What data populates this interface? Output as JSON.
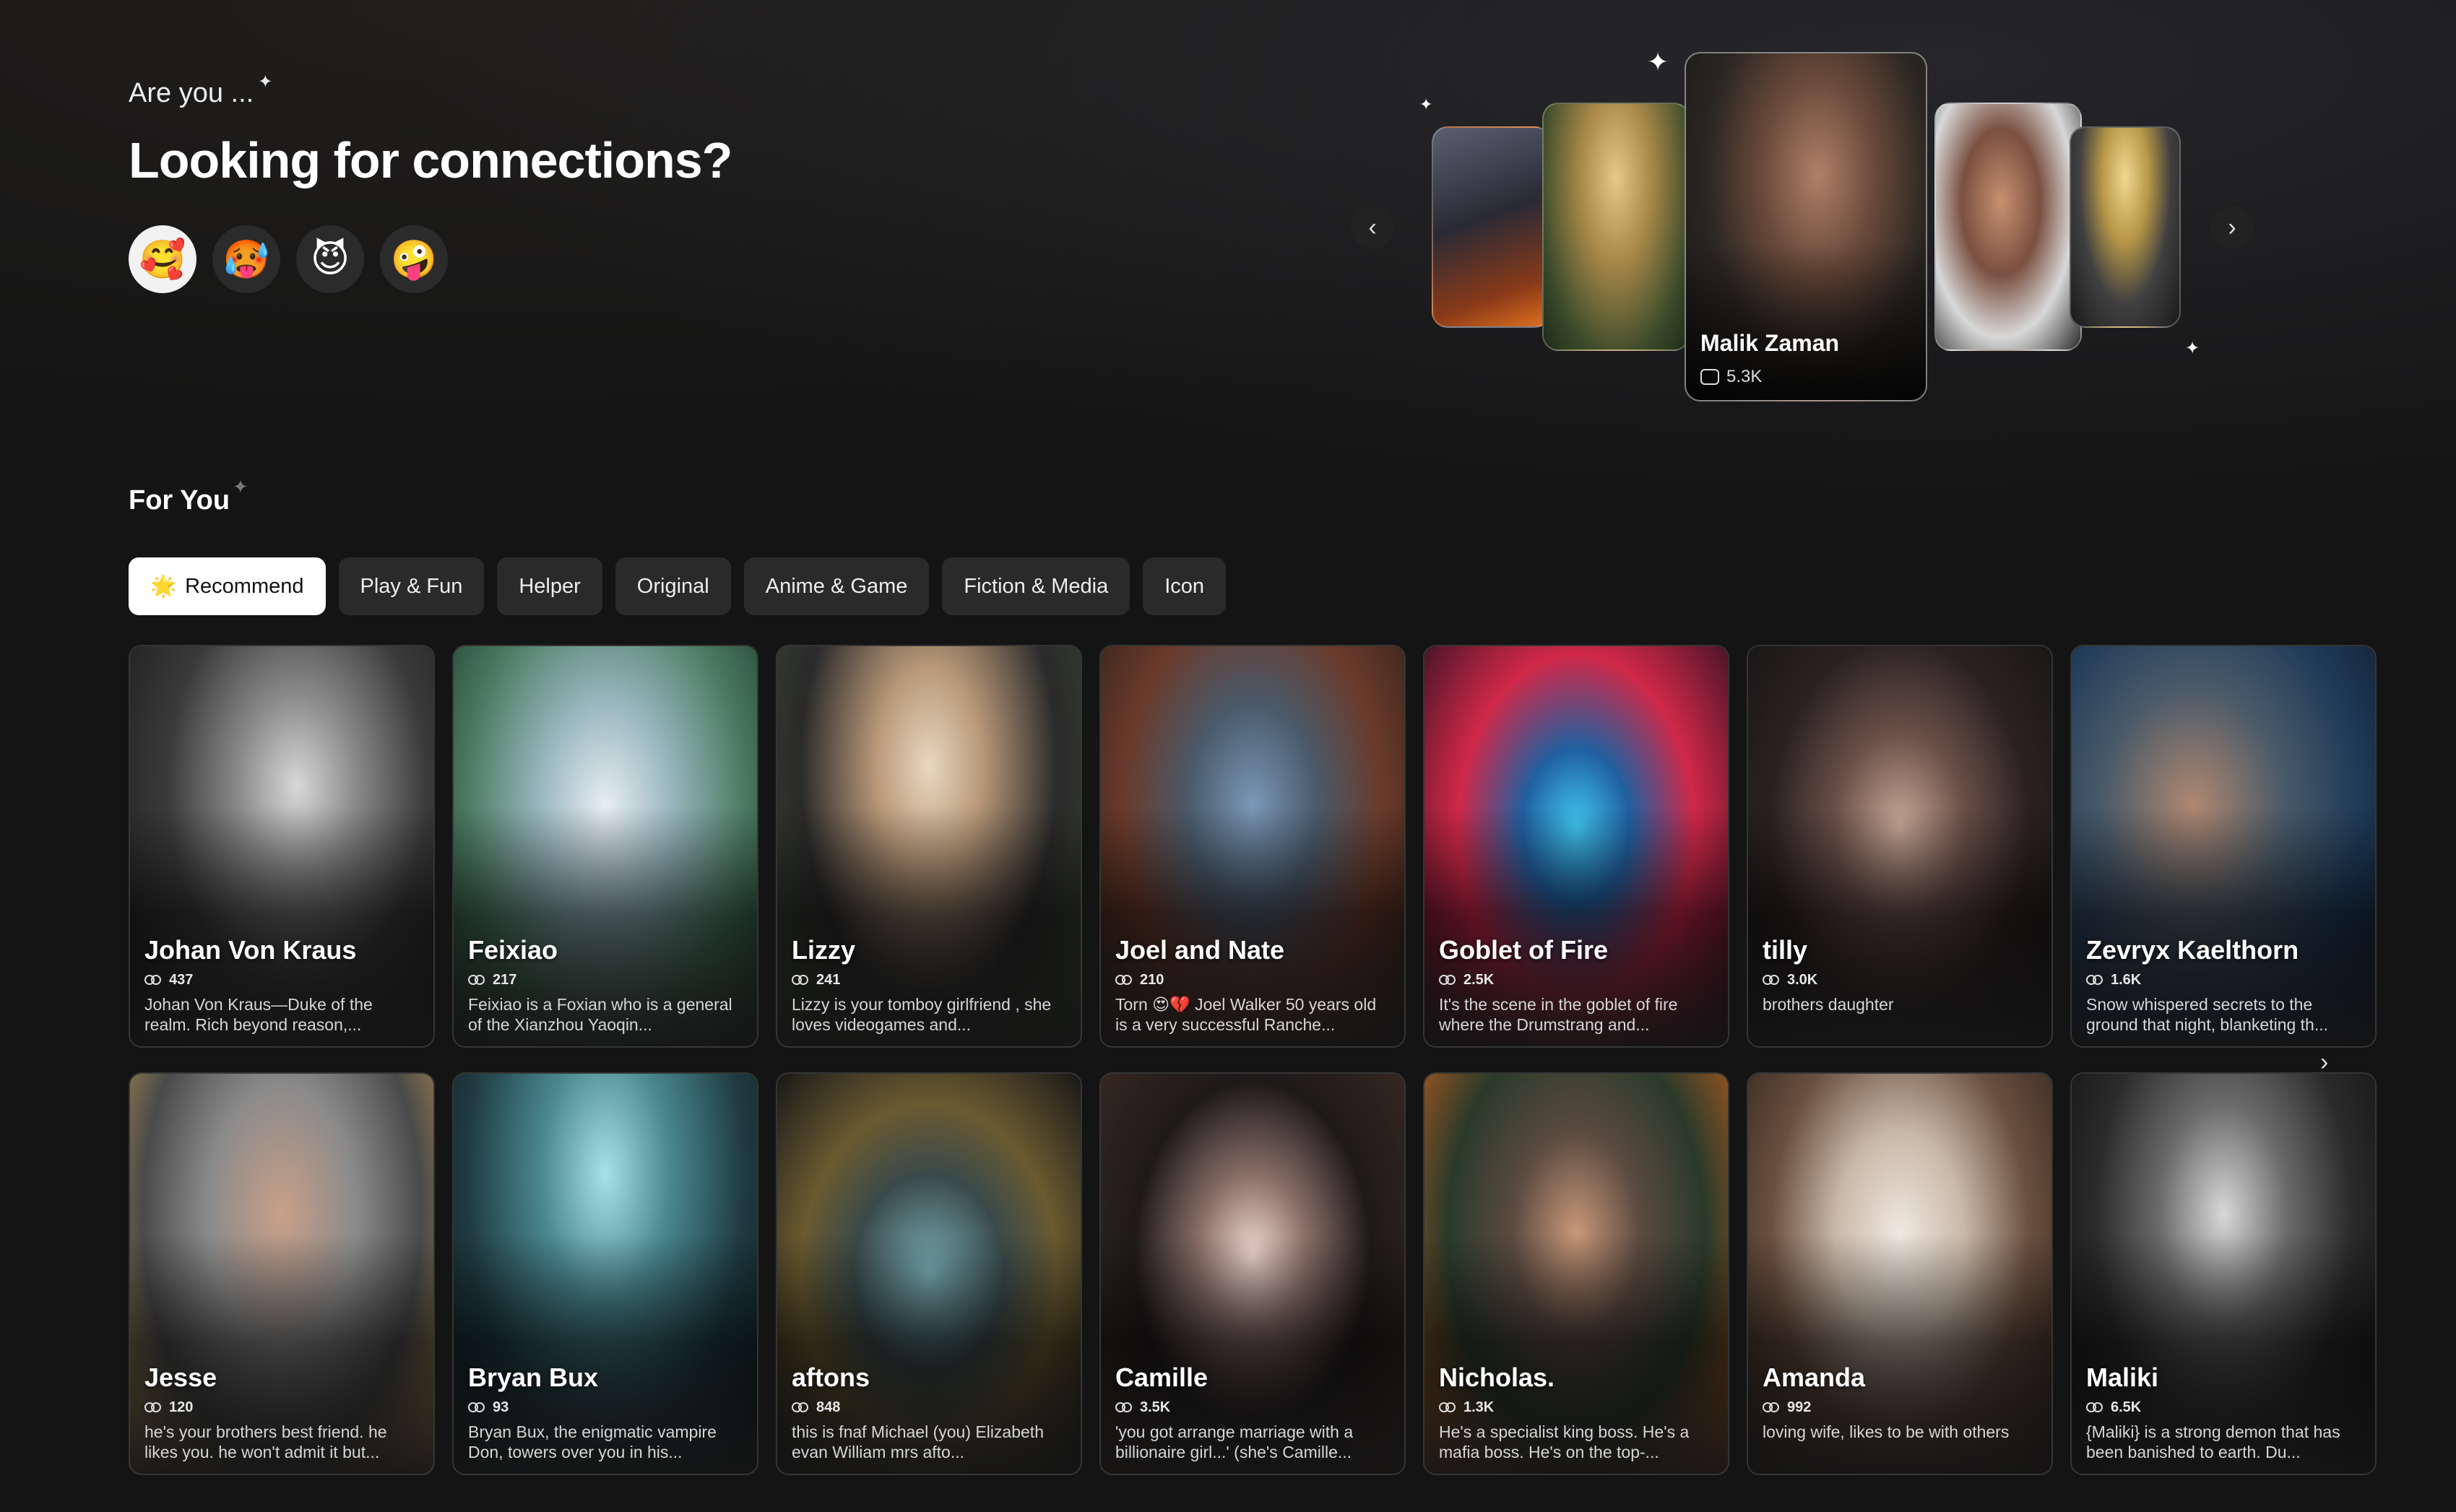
{
  "hero": {
    "subtitle": "Are you ...",
    "sparkle": "✦",
    "title": "Looking for connections?",
    "emojis": [
      "🥰",
      "🥵",
      "😈",
      "🤪"
    ]
  },
  "carousel": {
    "prev_label": "‹",
    "next_label": "›",
    "featured": {
      "name": "Malik Zaman",
      "count": "5.3K"
    }
  },
  "for_you": {
    "title": "For You",
    "sparkle": "✦",
    "tabs": [
      {
        "icon": "🌟",
        "label": "Recommend"
      },
      {
        "label": "Play & Fun"
      },
      {
        "label": "Helper"
      },
      {
        "label": "Original"
      },
      {
        "label": "Anime & Game"
      },
      {
        "label": "Fiction & Media"
      },
      {
        "label": "Icon"
      }
    ],
    "cards": [
      {
        "name": "Johan Von Kraus",
        "count": "437",
        "desc": "Johan Von Kraus—Duke of the realm. Rich beyond reason,..."
      },
      {
        "name": "Feixiao",
        "count": "217",
        "desc": "Feixiao is a Foxian who is a general of the Xianzhou Yaoqin..."
      },
      {
        "name": "Lizzy",
        "count": "241",
        "desc": "Lizzy is your tomboy girlfriend , she loves videogames and..."
      },
      {
        "name": "Joel and Nate",
        "count": "210",
        "desc": "Torn 😍💔 Joel Walker 50 years old is a very successful Ranche..."
      },
      {
        "name": "Goblet of Fire",
        "count": "2.5K",
        "desc": "It's the scene in the goblet of fire where the Drumstrang and..."
      },
      {
        "name": "tilly",
        "count": "3.0K",
        "desc": "brothers daughter"
      },
      {
        "name": "Zevryx Kaelthorn",
        "count": "1.6K",
        "desc": "Snow whispered secrets to the ground that night, blanketing th..."
      },
      {
        "name": "Jesse",
        "count": "120",
        "desc": "he's your brothers best friend. he likes you. he won't admit it but..."
      },
      {
        "name": "Bryan Bux",
        "count": "93",
        "desc": "Bryan Bux, the enigmatic vampire Don, towers over you in his..."
      },
      {
        "name": "aftons",
        "count": "848",
        "desc": "this is fnaf Michael (you) Elizabeth evan William mrs afto..."
      },
      {
        "name": "Camille",
        "count": "3.5K",
        "desc": "'you got arrange marriage with a billionaire girl...' (she's Camille..."
      },
      {
        "name": "Nicholas.",
        "count": "1.3K",
        "desc": "He's a specialist king boss. He's a mafia boss. He's on the top-..."
      },
      {
        "name": "Amanda",
        "count": "992",
        "desc": "loving wife, likes to be with others"
      },
      {
        "name": "Maliki",
        "count": "6.5K",
        "desc": "{Maliki} is a strong demon that has been banished to earth. Du..."
      }
    ],
    "next_label": "›"
  }
}
